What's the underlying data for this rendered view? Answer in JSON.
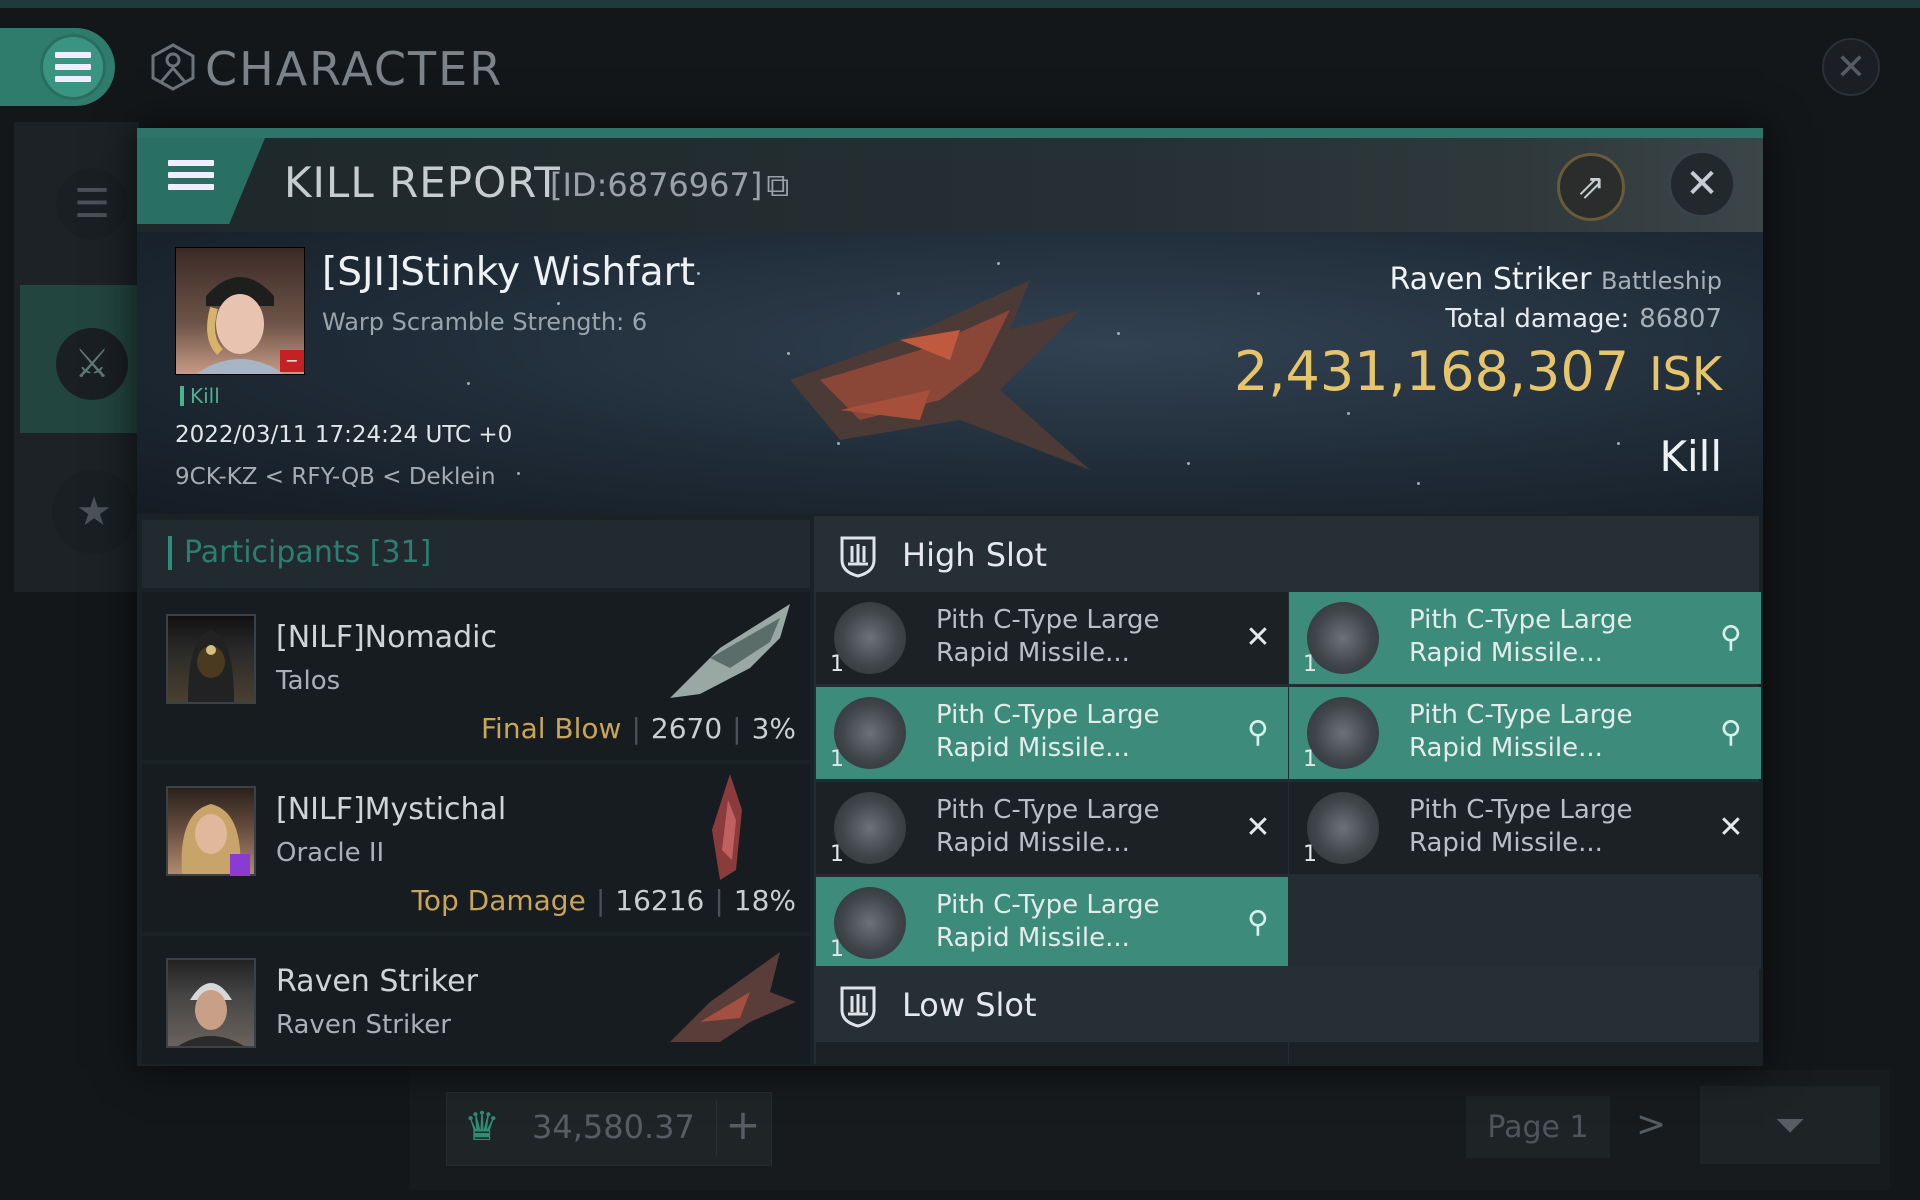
{
  "window": {
    "title": "CHARACTER",
    "close_icon": "close-icon"
  },
  "background": {
    "isk_value": "34,580.37",
    "plus_label": "+",
    "page_label": "Page 1",
    "next_label": ">"
  },
  "kill_report": {
    "title": "KILL REPORT",
    "id_label": "[ID:6876967]",
    "victim": {
      "name": "[SJI]Stinky Wishfart",
      "warp_scramble": "Warp Scramble Strength: 6",
      "kill_tag": "Kill",
      "datetime": "2022/03/11 17:24:24 UTC +0",
      "location": "9CK-KZ < RFY-QB < Deklein"
    },
    "ship": {
      "name": "Raven Striker",
      "class": "Battleship",
      "total_damage_label": "Total damage:",
      "total_damage": "86807",
      "isk_value": "2,431,168,307",
      "isk_unit": "ISK",
      "result": "Kill"
    }
  },
  "participants": {
    "label": "Participants",
    "count": "[31]",
    "rows": [
      {
        "name": "[NILF]Nomadic",
        "ship": "Talos",
        "tag": "Final Blow",
        "damage": "2670",
        "percent": "3%"
      },
      {
        "name": "[NILF]Mystichal",
        "ship": "Oracle II",
        "tag": "Top Damage",
        "damage": "16216",
        "percent": "18%"
      },
      {
        "name": "Raven Striker",
        "ship": "Raven Striker",
        "tag": "",
        "damage": "",
        "percent": ""
      }
    ]
  },
  "slots": {
    "high": {
      "title": "High Slot",
      "modules": [
        {
          "name": "Pith C-Type Large Rapid Missile...",
          "qty": "1",
          "status": "destroyed"
        },
        {
          "name": "Pith C-Type Large Rapid Missile...",
          "qty": "1",
          "status": "dropped"
        },
        {
          "name": "Pith C-Type Large Rapid Missile...",
          "qty": "1",
          "status": "dropped"
        },
        {
          "name": "Pith C-Type Large Rapid Missile...",
          "qty": "1",
          "status": "dropped"
        },
        {
          "name": "Pith C-Type Large Rapid Missile...",
          "qty": "1",
          "status": "destroyed"
        },
        {
          "name": "Pith C-Type Large Rapid Missile...",
          "qty": "1",
          "status": "destroyed"
        },
        {
          "name": "Pith C-Type Large Rapid Missile...",
          "qty": "1",
          "status": "dropped"
        }
      ]
    },
    "low": {
      "title": "Low Slot"
    }
  },
  "colors": {
    "accent": "#2f7c6d",
    "isk_gold": "#e7c56a",
    "dropped_bg": "#3d8c7b",
    "destroyed_bg": "#1b2125"
  }
}
